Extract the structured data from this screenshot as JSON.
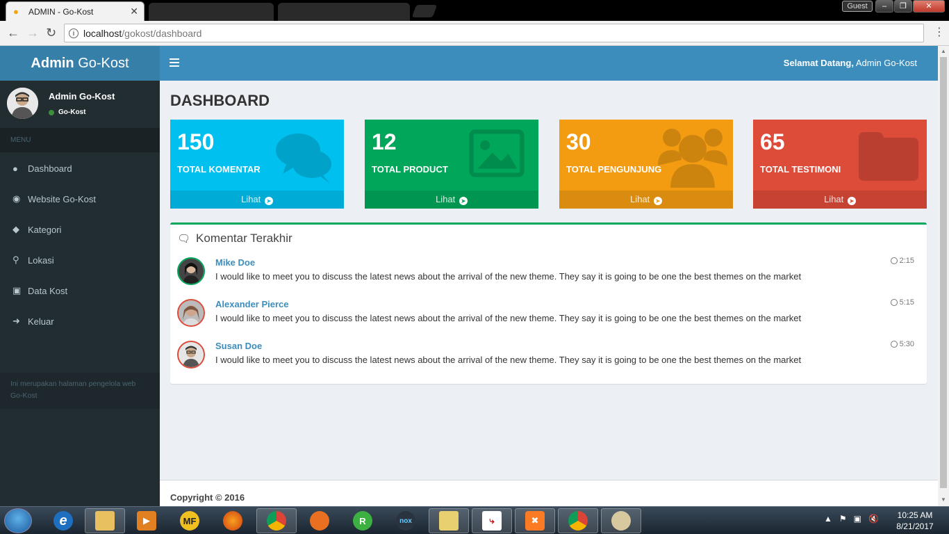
{
  "browser": {
    "active_tab_title": "ADMIN - Go-Kost",
    "guest_label": "Guest",
    "url_host": "localhost",
    "url_path": "/gokost/dashboard"
  },
  "header": {
    "logo_bold": "Admin",
    "logo_rest": "Go-Kost",
    "welcome_bold": "Selamat Datang,",
    "welcome_rest": "Admin Go-Kost"
  },
  "sidebar": {
    "user_name": "Admin Go-Kost",
    "user_status": "Go-Kost",
    "menu_header": "MENU",
    "items": [
      {
        "label": "Dashboard",
        "icon": "tachometer-icon"
      },
      {
        "label": "Website Go-Kost",
        "icon": "globe-icon"
      },
      {
        "label": "Kategori",
        "icon": "tag-icon"
      },
      {
        "label": "Lokasi",
        "icon": "map-marker-icon"
      },
      {
        "label": "Data Kost",
        "icon": "image-icon"
      },
      {
        "label": "Keluar",
        "icon": "sign-out-icon"
      }
    ],
    "note": "Ini merupakan halaman pengelola web Go-Kost"
  },
  "main": {
    "title": "DASHBOARD",
    "boxes": [
      {
        "value": "150",
        "label": "TOTAL KOMENTAR",
        "link": "Lihat",
        "color": "#00c0ef",
        "icon": "comments-icon"
      },
      {
        "value": "12",
        "label": "TOTAL PRODUCT",
        "link": "Lihat",
        "color": "#00a65a",
        "icon": "image-icon"
      },
      {
        "value": "30",
        "label": "TOTAL PENGUNJUNG",
        "link": "Lihat",
        "color": "#f39c12",
        "icon": "users-icon"
      },
      {
        "value": "65",
        "label": "TOTAL TESTIMONI",
        "link": "Lihat",
        "color": "#dd4b39",
        "icon": "folder-icon"
      }
    ],
    "comments": {
      "title": "Komentar Terakhir",
      "items": [
        {
          "name": "Mike Doe",
          "time": "2:15",
          "text": "I would like to meet you to discuss the latest news about the arrival of the new theme. They say it is going to be one the best themes on the market"
        },
        {
          "name": "Alexander Pierce",
          "time": "5:15",
          "text": "I would like to meet you to discuss the latest news about the arrival of the new theme. They say it is going to be one the best themes on the market"
        },
        {
          "name": "Susan Doe",
          "time": "5:30",
          "text": "I would like to meet you to discuss the latest news about the arrival of the new theme. They say it is going to be one the best themes on the market"
        }
      ]
    }
  },
  "footer": {
    "copyright": "Copyright © 2016"
  },
  "taskbar": {
    "time": "10:25 AM",
    "date": "8/21/2017",
    "apps": [
      "internet-explorer-icon",
      "file-explorer-icon",
      "media-player-icon",
      "mf-icon",
      "firefox-icon",
      "chrome-icon",
      "keyhole-icon",
      "r-icon",
      "nox-icon",
      "folder-app-icon",
      "filezilla-icon",
      "xampp-icon",
      "chrome-icon",
      "paint-icon"
    ]
  }
}
